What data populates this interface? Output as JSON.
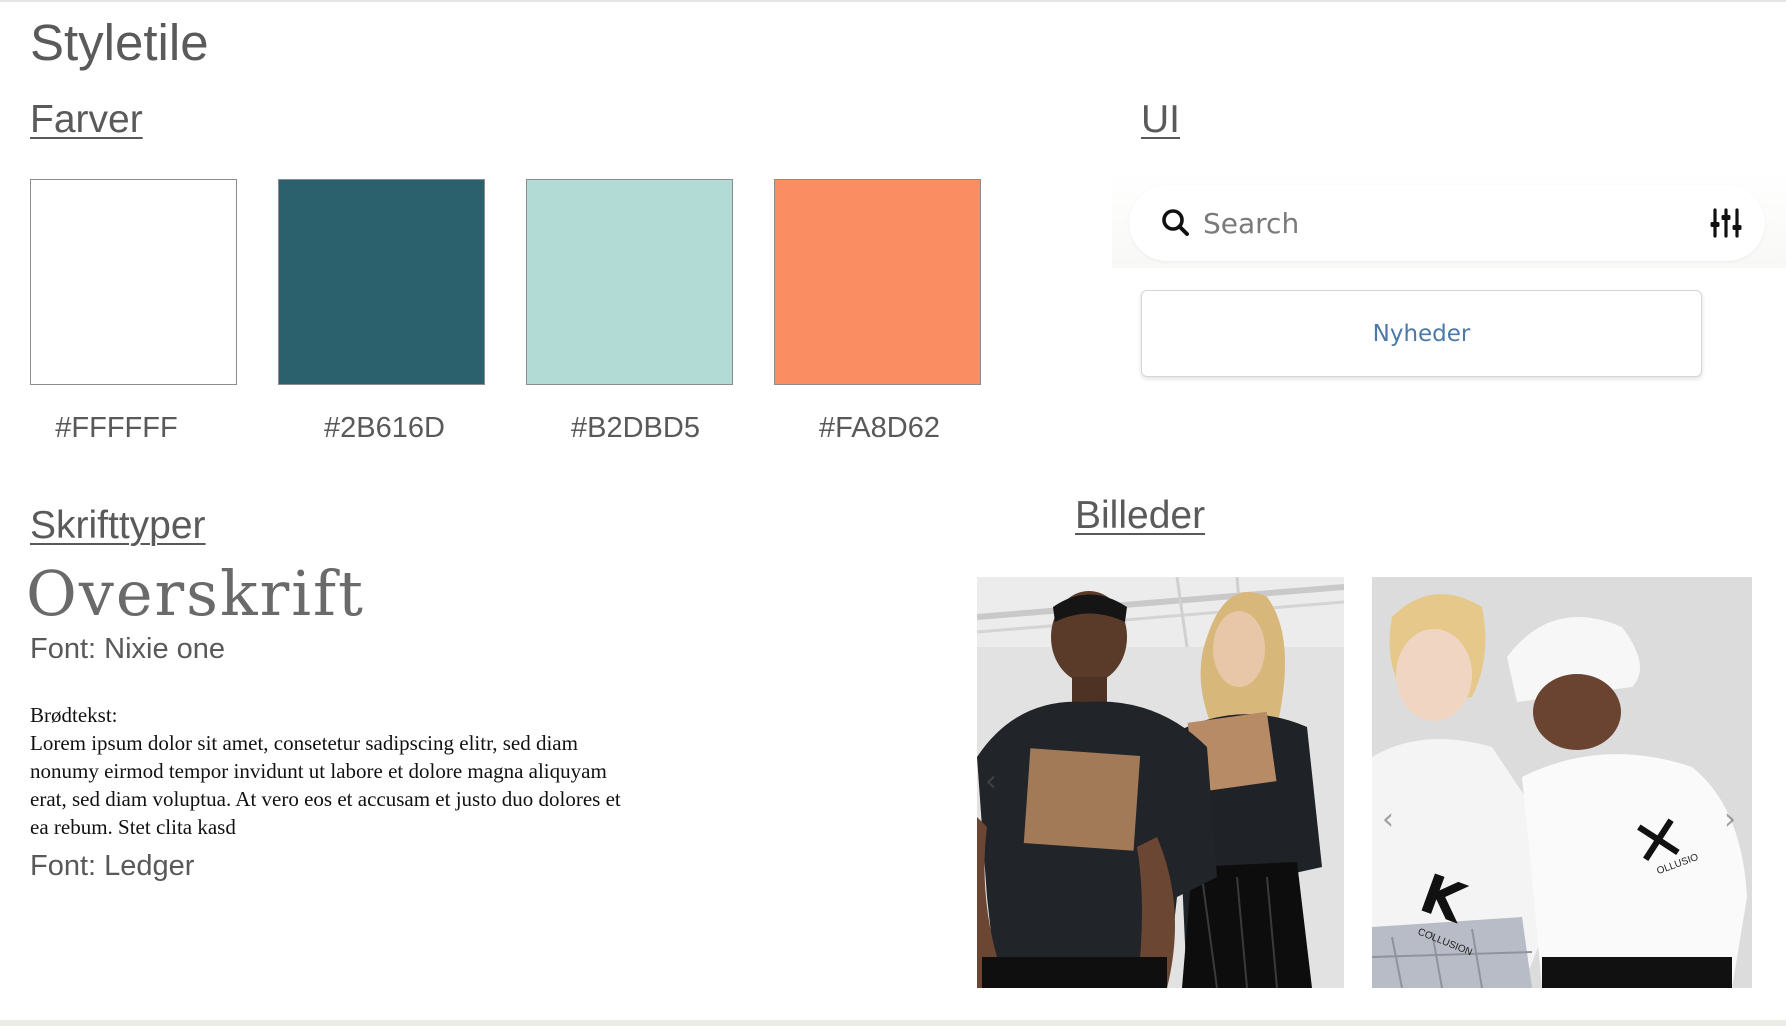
{
  "page": {
    "title": "Styletile"
  },
  "colors": {
    "heading": "Farver",
    "swatches": [
      {
        "hex": "#FFFFFF",
        "label": "#FFFFFF"
      },
      {
        "hex": "#2B616D",
        "label": "#2B616D"
      },
      {
        "hex": "#B2DBD5",
        "label": "#B2DBD5"
      },
      {
        "hex": "#FA8D62",
        "label": "#FA8D62"
      }
    ]
  },
  "ui": {
    "heading": "UI",
    "search": {
      "placeholder": "Search",
      "value": "",
      "icon": "search-icon",
      "filter_icon": "sliders-icon"
    },
    "button": {
      "label": "Nyheder",
      "color": "#4B79A8"
    }
  },
  "fonts": {
    "heading": "Skrifttyper",
    "headline_sample": "Overskrift",
    "headline_font_caption": "Font: Nixie one",
    "body_label": "Brødtekst:",
    "body_sample": "Lorem ipsum dolor sit amet, consetetur sadipscing elitr, sed diam nonumy eirmod tempor invidunt ut labore et dolore magna aliquyam erat, sed diam voluptua. At vero eos et accusam et justo duo dolores et ea rebum. Stet clita kasd",
    "body_font_caption": "Font: Ledger"
  },
  "images": {
    "heading": "Billeder",
    "photos": [
      {
        "name": "photo-dark-tshirts",
        "prev_icon": "chevron-left-icon"
      },
      {
        "name": "photo-white-tshirts",
        "prev_icon": "chevron-left-icon",
        "next_icon": "chevron-right-icon",
        "print": "COLLUSION",
        "print_small": "OLLUSIO"
      }
    ]
  }
}
